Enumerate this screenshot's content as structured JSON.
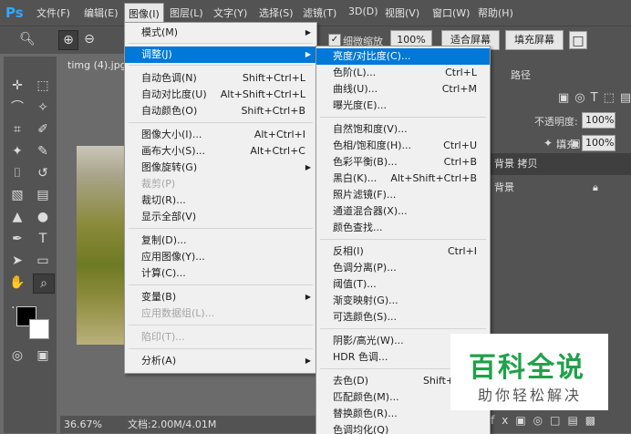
{
  "menubar": {
    "logo": "Ps",
    "items": [
      "文件(F)",
      "编辑(E)",
      "图像(I)",
      "图层(L)",
      "文字(Y)",
      "选择(S)",
      "滤镜(T)",
      "3D(D)",
      "视图(V)",
      "窗口(W)",
      "帮助(H)"
    ]
  },
  "options": {
    "fine_zoom_label": "细微缩放",
    "zoom_100": "100%",
    "fit_screen": "适合屏幕",
    "fill_screen": "填充屏幕"
  },
  "document": {
    "tab_title": "timg (4).jpg",
    "zoom": "36.67%",
    "doc_info": "文档:2.00M/4.01M"
  },
  "panel": {
    "tab_paths": "路径",
    "opacity_label": "不透明度:",
    "opacity_value": "100%",
    "fill_label": "填充:",
    "fill_value": "100%",
    "layers": [
      {
        "name": "背景 拷贝"
      },
      {
        "name": "背景"
      }
    ]
  },
  "image_menu": {
    "items": [
      {
        "label": "模式(M)",
        "shortcut": "",
        "submenu": true
      },
      {
        "label": "调整(J)",
        "shortcut": "",
        "submenu": true,
        "highlighted": true
      },
      {
        "label": "自动色调(N)",
        "shortcut": "Shift+Ctrl+L"
      },
      {
        "label": "自动对比度(U)",
        "shortcut": "Alt+Shift+Ctrl+L"
      },
      {
        "label": "自动颜色(O)",
        "shortcut": "Shift+Ctrl+B"
      },
      {
        "label": "图像大小(I)...",
        "shortcut": "Alt+Ctrl+I"
      },
      {
        "label": "画布大小(S)...",
        "shortcut": "Alt+Ctrl+C"
      },
      {
        "label": "图像旋转(G)",
        "shortcut": "",
        "submenu": true
      },
      {
        "label": "裁剪(P)",
        "shortcut": "",
        "disabled": true
      },
      {
        "label": "裁切(R)...",
        "shortcut": ""
      },
      {
        "label": "显示全部(V)",
        "shortcut": ""
      },
      {
        "label": "复制(D)...",
        "shortcut": ""
      },
      {
        "label": "应用图像(Y)...",
        "shortcut": ""
      },
      {
        "label": "计算(C)...",
        "shortcut": ""
      },
      {
        "label": "变量(B)",
        "shortcut": "",
        "submenu": true
      },
      {
        "label": "应用数据组(L)...",
        "shortcut": "",
        "disabled": true
      },
      {
        "label": "陷印(T)...",
        "shortcut": "",
        "disabled": true
      },
      {
        "label": "分析(A)",
        "shortcut": "",
        "submenu": true
      }
    ]
  },
  "adjust_menu": {
    "items": [
      {
        "label": "亮度/对比度(C)...",
        "shortcut": "",
        "highlighted": true
      },
      {
        "label": "色阶(L)...",
        "shortcut": "Ctrl+L"
      },
      {
        "label": "曲线(U)...",
        "shortcut": "Ctrl+M"
      },
      {
        "label": "曝光度(E)...",
        "shortcut": ""
      },
      {
        "label": "自然饱和度(V)...",
        "shortcut": ""
      },
      {
        "label": "色相/饱和度(H)...",
        "shortcut": "Ctrl+U"
      },
      {
        "label": "色彩平衡(B)...",
        "shortcut": "Ctrl+B"
      },
      {
        "label": "黑白(K)...",
        "shortcut": "Alt+Shift+Ctrl+B"
      },
      {
        "label": "照片滤镜(F)...",
        "shortcut": ""
      },
      {
        "label": "通道混合器(X)...",
        "shortcut": ""
      },
      {
        "label": "颜色查找...",
        "shortcut": ""
      },
      {
        "label": "反相(I)",
        "shortcut": "Ctrl+I"
      },
      {
        "label": "色调分离(P)...",
        "shortcut": ""
      },
      {
        "label": "阈值(T)...",
        "shortcut": ""
      },
      {
        "label": "渐变映射(G)...",
        "shortcut": ""
      },
      {
        "label": "可选颜色(S)...",
        "shortcut": ""
      },
      {
        "label": "阴影/高光(W)...",
        "shortcut": ""
      },
      {
        "label": "HDR 色调...",
        "shortcut": ""
      },
      {
        "label": "去色(D)",
        "shortcut": "Shift+Ctrl+U"
      },
      {
        "label": "匹配颜色(M)...",
        "shortcut": ""
      },
      {
        "label": "替换颜色(R)...",
        "shortcut": ""
      },
      {
        "label": "色调均化(Q)",
        "shortcut": ""
      }
    ]
  },
  "watermark": {
    "title": "百科全说",
    "subtitle": "助你轻松解决"
  }
}
